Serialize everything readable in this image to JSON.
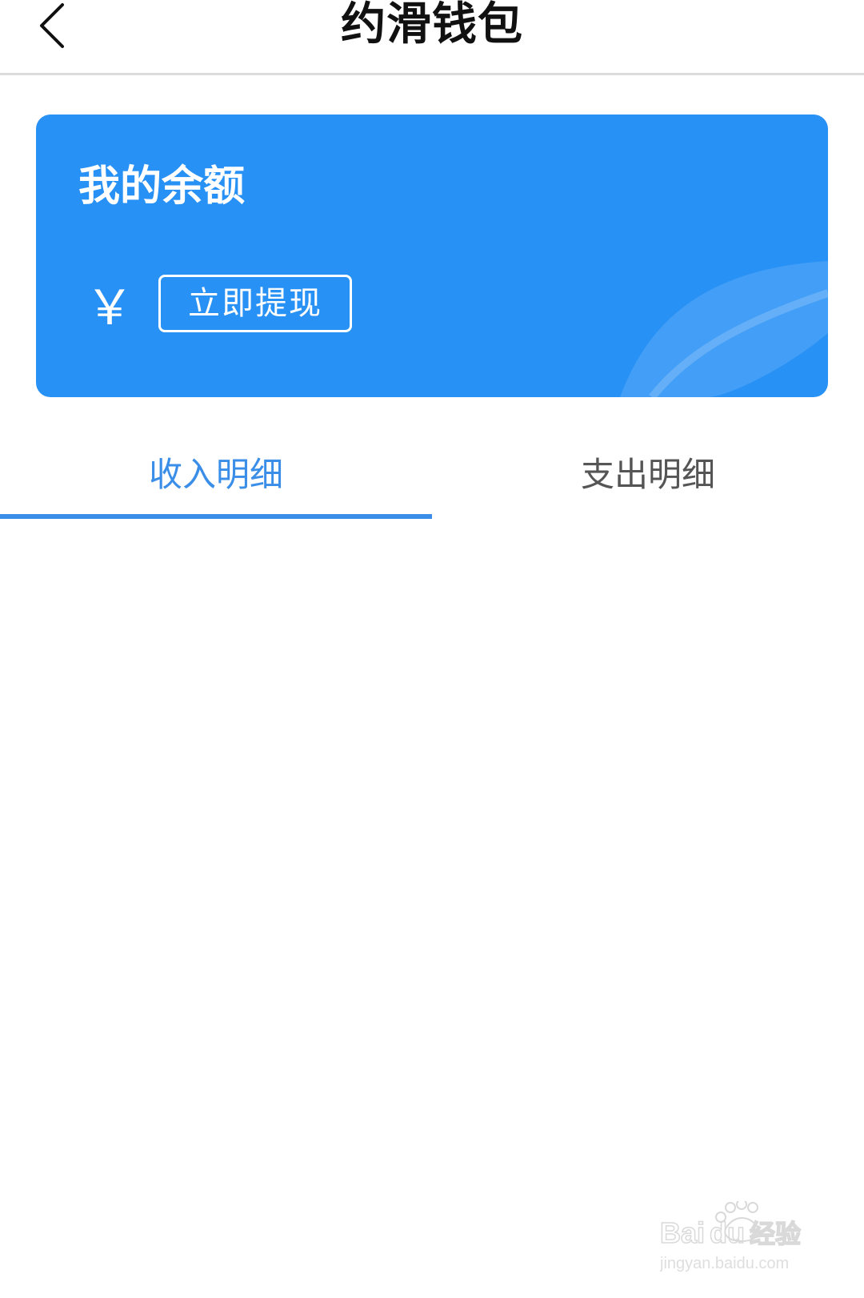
{
  "header": {
    "title": "约滑钱包",
    "back_icon": "chevron-left-icon"
  },
  "balance_card": {
    "title": "我的余额",
    "currency_symbol": "￥",
    "withdraw_label": "立即提现",
    "color": "#2891f5"
  },
  "tabs": [
    {
      "label": "收入明细",
      "active": true
    },
    {
      "label": "支出明细",
      "active": false
    }
  ],
  "colors": {
    "accent": "#3b8ee8",
    "inactive_tab": "#555555"
  },
  "watermark": {
    "text_main": "Baidu经验",
    "text_sub": "jingyan.baidu.com"
  }
}
